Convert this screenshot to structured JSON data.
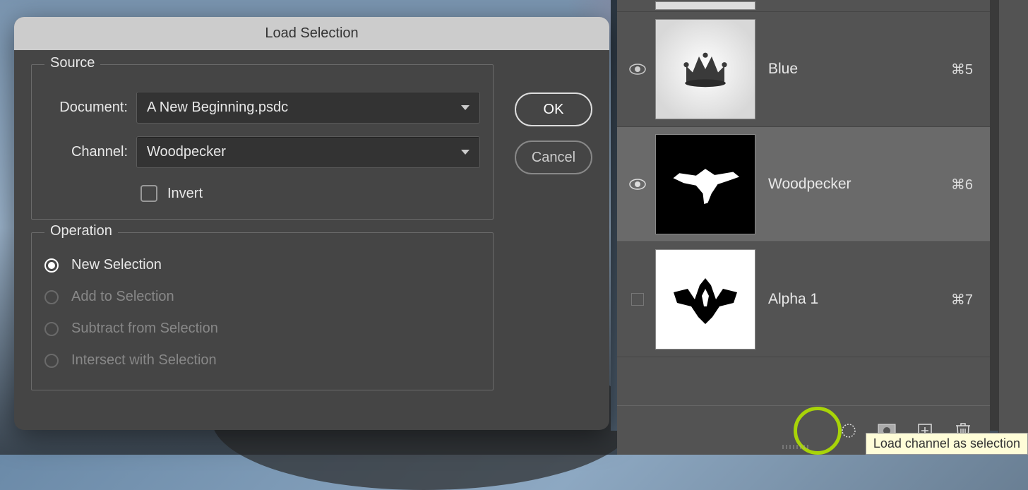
{
  "dialog": {
    "title": "Load Selection",
    "buttons": {
      "ok": "OK",
      "cancel": "Cancel"
    },
    "source": {
      "legend": "Source",
      "document_label": "Document:",
      "document_value": "A New Beginning.psdc",
      "channel_label": "Channel:",
      "channel_value": "Woodpecker",
      "invert_label": "Invert",
      "invert_checked": false
    },
    "operation": {
      "legend": "Operation",
      "selected": 0,
      "options": [
        {
          "label": "New Selection",
          "enabled": true
        },
        {
          "label": "Add to Selection",
          "enabled": false
        },
        {
          "label": "Subtract from Selection",
          "enabled": false
        },
        {
          "label": "Intersect with Selection",
          "enabled": false
        }
      ]
    }
  },
  "channels": [
    {
      "name": "Blue",
      "shortcut": "⌘5",
      "visible": true,
      "selected": false,
      "thumb": "blue"
    },
    {
      "name": "Woodpecker",
      "shortcut": "⌘6",
      "visible": true,
      "selected": true,
      "thumb": "woodpecker"
    },
    {
      "name": "Alpha 1",
      "shortcut": "⌘7",
      "visible": false,
      "selected": false,
      "thumb": "alpha"
    }
  ],
  "footer": {
    "load_selection": "load-selection-icon",
    "save_mask": "mask-icon",
    "new_channel": "new-icon",
    "delete": "trash-icon"
  },
  "tooltip": "Load channel as selection"
}
